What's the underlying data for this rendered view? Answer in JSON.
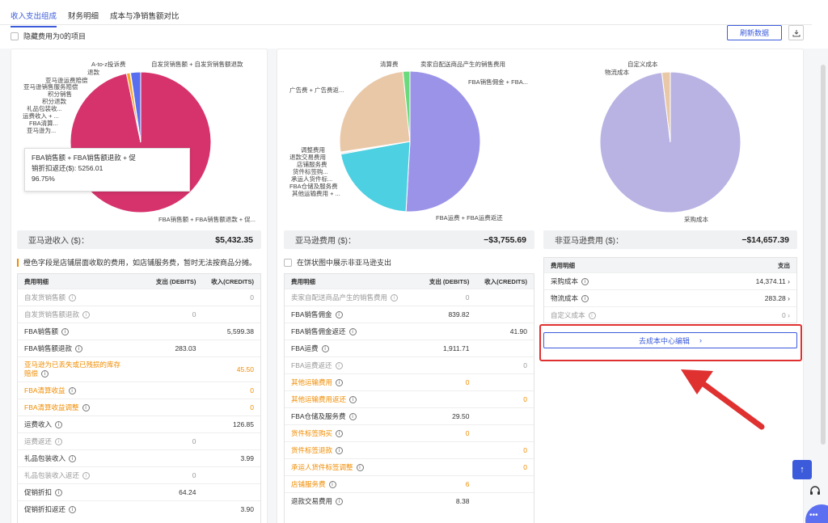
{
  "tabs": [
    "收入支出组成",
    "财务明细",
    "成本与净销售额对比"
  ],
  "hide_zero_label": "隐藏费用为0的项目",
  "refresh_label": "刷新数据",
  "chart_data": [
    {
      "type": "pie",
      "slices": [
        {
          "label": "FBA销售额 + FBA销售额退款 + 促...",
          "value": 96.75,
          "color": "#d6336c"
        },
        {
          "label": "亚马逊为...",
          "value": 0.84,
          "color": "#f5a623"
        },
        {
          "label": "A-to-z投诉费",
          "value": 0.1,
          "color": "#f8b4c8"
        },
        {
          "label": "自发货销售额 + 自发货销售额退款",
          "value": 2.31,
          "color": "#5a6ff0"
        }
      ],
      "labels_left": [
        "A-to-z投诉费",
        "退款",
        "亚马逊运费赔偿",
        "亚马逊销售服务赔偿",
        "积分销售",
        "积分退款",
        "礼品包装收...",
        "运费收入 + ...",
        "FBA清算...",
        "亚马逊为..."
      ],
      "label_top_right": "自发货销售额 + 自发货销售额退款",
      "label_bottom_right": "FBA销售额 + FBA销售额退款 + 促...",
      "tooltip": {
        "line1": "FBA销售额 + FBA销售额退款 + 促",
        "line2": "销折扣返还($): 5256.01",
        "line3": "96.75%"
      }
    },
    {
      "type": "pie",
      "slices": [
        {
          "label": "FBA运费 + FBA运费返还",
          "value": 50.9,
          "color": "#9b93e8"
        },
        {
          "label": "FBA销售佣金 + FBA...",
          "value": 21.2,
          "color": "#4dd0e1"
        },
        {
          "label": "卖家自配送商品产生的销售费用",
          "value": 0.3,
          "color": "#d9d9d9"
        },
        {
          "label": "清算费",
          "value": 0.2,
          "color": "#bfbfbf"
        },
        {
          "label": "广告费 + 广告费返...",
          "value": 25.8,
          "color": "#e9c8a8"
        },
        {
          "label": "其他",
          "value": 1.6,
          "color": "#69db7c"
        }
      ],
      "labels_left": [
        "调整费用",
        "退款交易费用",
        "店铺服务费",
        "货件标签购...",
        "承运人货件标...",
        "FBA仓储及服务费",
        "其他运输费用 + ..."
      ],
      "label_top_left": "清算费",
      "label_top_mid": "卖家自配送商品产生的销售费用",
      "label_right": "FBA销售佣金 + FBA...",
      "label_ad": "广告费 + 广告费返...",
      "label_bottom": "FBA运费 + FBA运费返还"
    },
    {
      "type": "pie",
      "slices": [
        {
          "label": "采购成本",
          "value": 98.07,
          "color": "#b8b3e3"
        },
        {
          "label": "物流成本",
          "value": 1.93,
          "color": "#e9c8a8"
        },
        {
          "label": "自定义成本",
          "value": 0.0,
          "color": "#d9d9d9"
        }
      ],
      "label_top1": "自定义成本",
      "label_top2": "物流成本",
      "label_bottom": "采购成本"
    }
  ],
  "summary": {
    "amazon_income_label": "亚马逊收入 ($)：",
    "amazon_income_value": "$5,432.35",
    "amazon_fee_label": "亚马逊费用 ($)：",
    "amazon_fee_value": "−$3,755.69",
    "non_amazon_fee_label": "非亚马逊费用 ($)：",
    "non_amazon_fee_value": "−$14,657.39"
  },
  "note_orange": "橙色字段是店铺层面收取的费用，如店铺服务费，暂时无法按商品分摊。",
  "note_pie_toggle": "在饼状图中展示非亚马逊支出",
  "income_table": {
    "headers": [
      "费用明细",
      "支出 (DEBITS)",
      "收入(CREDITS)"
    ],
    "rows": [
      {
        "name": "自发货销售额",
        "debit": "",
        "credit": "0",
        "style": "muted"
      },
      {
        "name": "自发货销售额退款",
        "debit": "0",
        "credit": "",
        "style": "muted"
      },
      {
        "name": "FBA销售额",
        "debit": "",
        "credit": "5,599.38",
        "style": ""
      },
      {
        "name": "FBA销售额退款",
        "debit": "283.03",
        "credit": "",
        "style": ""
      },
      {
        "name": "亚马逊为已丢失或已残损的库存",
        "name2": "赔偿",
        "debit": "",
        "credit": "45.50",
        "style": "orange"
      },
      {
        "name": "FBA清算收益",
        "debit": "",
        "credit": "0",
        "style": "orange"
      },
      {
        "name": "FBA清算收益调整",
        "debit": "",
        "credit": "0",
        "style": "orange"
      },
      {
        "name": "运费收入",
        "debit": "",
        "credit": "126.85",
        "style": ""
      },
      {
        "name": "运费返还",
        "debit": "0",
        "credit": "",
        "style": "muted"
      },
      {
        "name": "礼品包装收入",
        "debit": "",
        "credit": "3.99",
        "style": ""
      },
      {
        "name": "礼品包装收入返还",
        "debit": "0",
        "credit": "",
        "style": "muted"
      },
      {
        "name": "促销折扣",
        "debit": "64.24",
        "credit": "",
        "style": ""
      },
      {
        "name": "促销折扣返还",
        "debit": "",
        "credit": "3.90",
        "style": ""
      }
    ]
  },
  "fee_table": {
    "headers": [
      "费用明细",
      "支出 (DEBITS)",
      "收入(CREDITS)"
    ],
    "rows": [
      {
        "name": "卖家自配送商品产生的销售费用",
        "debit": "0",
        "credit": "",
        "style": "muted"
      },
      {
        "name": "FBA销售佣金",
        "debit": "839.82",
        "credit": "",
        "style": ""
      },
      {
        "name": "FBA销售佣金返还",
        "debit": "",
        "credit": "41.90",
        "style": ""
      },
      {
        "name": "FBA运费",
        "debit": "1,911.71",
        "credit": "",
        "style": ""
      },
      {
        "name": "FBA运费返还",
        "debit": "",
        "credit": "0",
        "style": "muted"
      },
      {
        "name": "其他运输费用",
        "debit": "0",
        "credit": "",
        "style": "orange"
      },
      {
        "name": "其他运输费用返还",
        "debit": "",
        "credit": "0",
        "style": "orange"
      },
      {
        "name": "FBA仓储及服务费",
        "debit": "29.50",
        "credit": "",
        "style": ""
      },
      {
        "name": "货件标签购买",
        "debit": "0",
        "credit": "",
        "style": "orange"
      },
      {
        "name": "货件标签退款",
        "debit": "",
        "credit": "0",
        "style": "orange"
      },
      {
        "name": "承运人货件标签调整",
        "debit": "",
        "credit": "0",
        "style": "orange"
      },
      {
        "name": "店铺服务费",
        "debit": "6",
        "credit": "",
        "style": "orange"
      },
      {
        "name": "退款交易费用",
        "debit": "8.38",
        "credit": "",
        "style": ""
      }
    ]
  },
  "cost_table": {
    "headers": [
      "费用明细",
      "支出"
    ],
    "rows": [
      {
        "name": "采购成本",
        "value": "14,374.11",
        "style": ""
      },
      {
        "name": "物流成本",
        "value": "283.28",
        "style": ""
      },
      {
        "name": "自定义成本",
        "value": "0",
        "style": "muted"
      }
    ]
  },
  "goto_cost_label": "去成本中心编辑",
  "colors": {
    "accent": "#3b5bdb",
    "orange": "#f08c00",
    "highlight": "#e03131"
  }
}
